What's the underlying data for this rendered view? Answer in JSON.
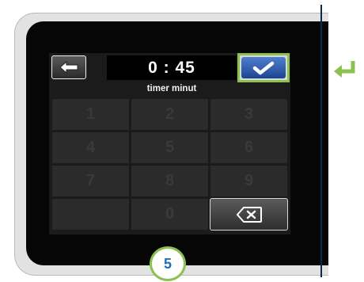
{
  "time_display": "0 : 45",
  "time_unit_label": "timer minut",
  "keypad": {
    "rows": [
      [
        "1",
        "2",
        "3"
      ],
      [
        "4",
        "5",
        "6"
      ],
      [
        "7",
        "8",
        "9"
      ],
      [
        "",
        "0",
        "delete"
      ]
    ]
  },
  "step_number": "5",
  "colors": {
    "accent_green": "#8cc04f",
    "confirm_blue": "#2b5aa8",
    "step_blue": "#1c6db3"
  },
  "icons": {
    "back": "left-arrow-icon",
    "confirm": "checkmark-icon",
    "delete": "backspace-icon",
    "annotation": "enter-return-icon"
  }
}
